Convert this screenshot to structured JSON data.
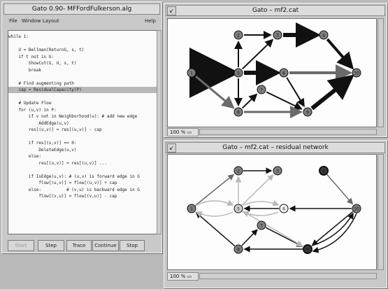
{
  "editor": {
    "title": "Gato 0.90- MFFordFulkerson.alg",
    "menu": {
      "file": "File",
      "window_layout": "Window Layout",
      "help": "Help"
    },
    "code_lines": [
      "while 1:",
      "",
      "    U = Bellman(ReturnG, s, t)",
      "    if t not in U:",
      "        ShowCut(G, U, s, t)",
      "        break",
      "",
      "    # Find augmenting path",
      "    cap = ResidualCapacity(P)",
      "",
      "    # Update Flow",
      "    for (u,v) in P:",
      "        if v not in Neighborhood(u): # add new edge",
      "            AddEdge(u,v)",
      "        res[(u,v)] = res[(u,v)] - cap",
      "",
      "        if res[(u,v)] == 0:",
      "            DeleteEdge(u,v)",
      "        else:",
      "            res[(u,v)] = res[(u,v)] ...",
      "",
      "        if IsEdge(u,v): # (u,v) is forward edge in G",
      "            flow[(u,v)] = flow[(u,v)] + cap",
      "        else:          # (v,u) is backward edge in G",
      "            flow[(v,u)] = flow[(v,u)] - cap"
    ],
    "highlight_line": 8,
    "buttons": {
      "start": "Start",
      "step": "Step",
      "trace": "Trace",
      "continue": "Continue",
      "stop": "Stop"
    }
  },
  "graph_window": {
    "title": "Gato – mf2.cat",
    "zoom": "100 %"
  },
  "residual_window": {
    "title": "Gato – mf2.cat – residual network",
    "zoom": "100 %"
  },
  "graph_nodes": [
    {
      "id": "1"
    },
    {
      "id": "2"
    },
    {
      "id": "3"
    },
    {
      "id": "4"
    },
    {
      "id": "5"
    },
    {
      "id": "6"
    },
    {
      "id": "7"
    },
    {
      "id": "8"
    },
    {
      "id": "9"
    },
    {
      "id": "10"
    }
  ],
  "residual_nodes": [
    {
      "id": "1"
    },
    {
      "id": "2"
    },
    {
      "id": "3"
    },
    {
      "id": "4"
    },
    {
      "id": "5"
    },
    {
      "id": "6"
    },
    {
      "id": "7"
    },
    {
      "id": "8"
    },
    {
      "id": "9"
    },
    {
      "id": "10"
    }
  ],
  "colors": {
    "node_gray": "#7e7e7e",
    "node_dark": "#3a3a3a",
    "node_light": "#cfcfcf",
    "edge_black": "#111111",
    "edge_gray": "#6a6a6a",
    "edge_light": "#b9b9b9",
    "selection": "#b8b8b8"
  }
}
